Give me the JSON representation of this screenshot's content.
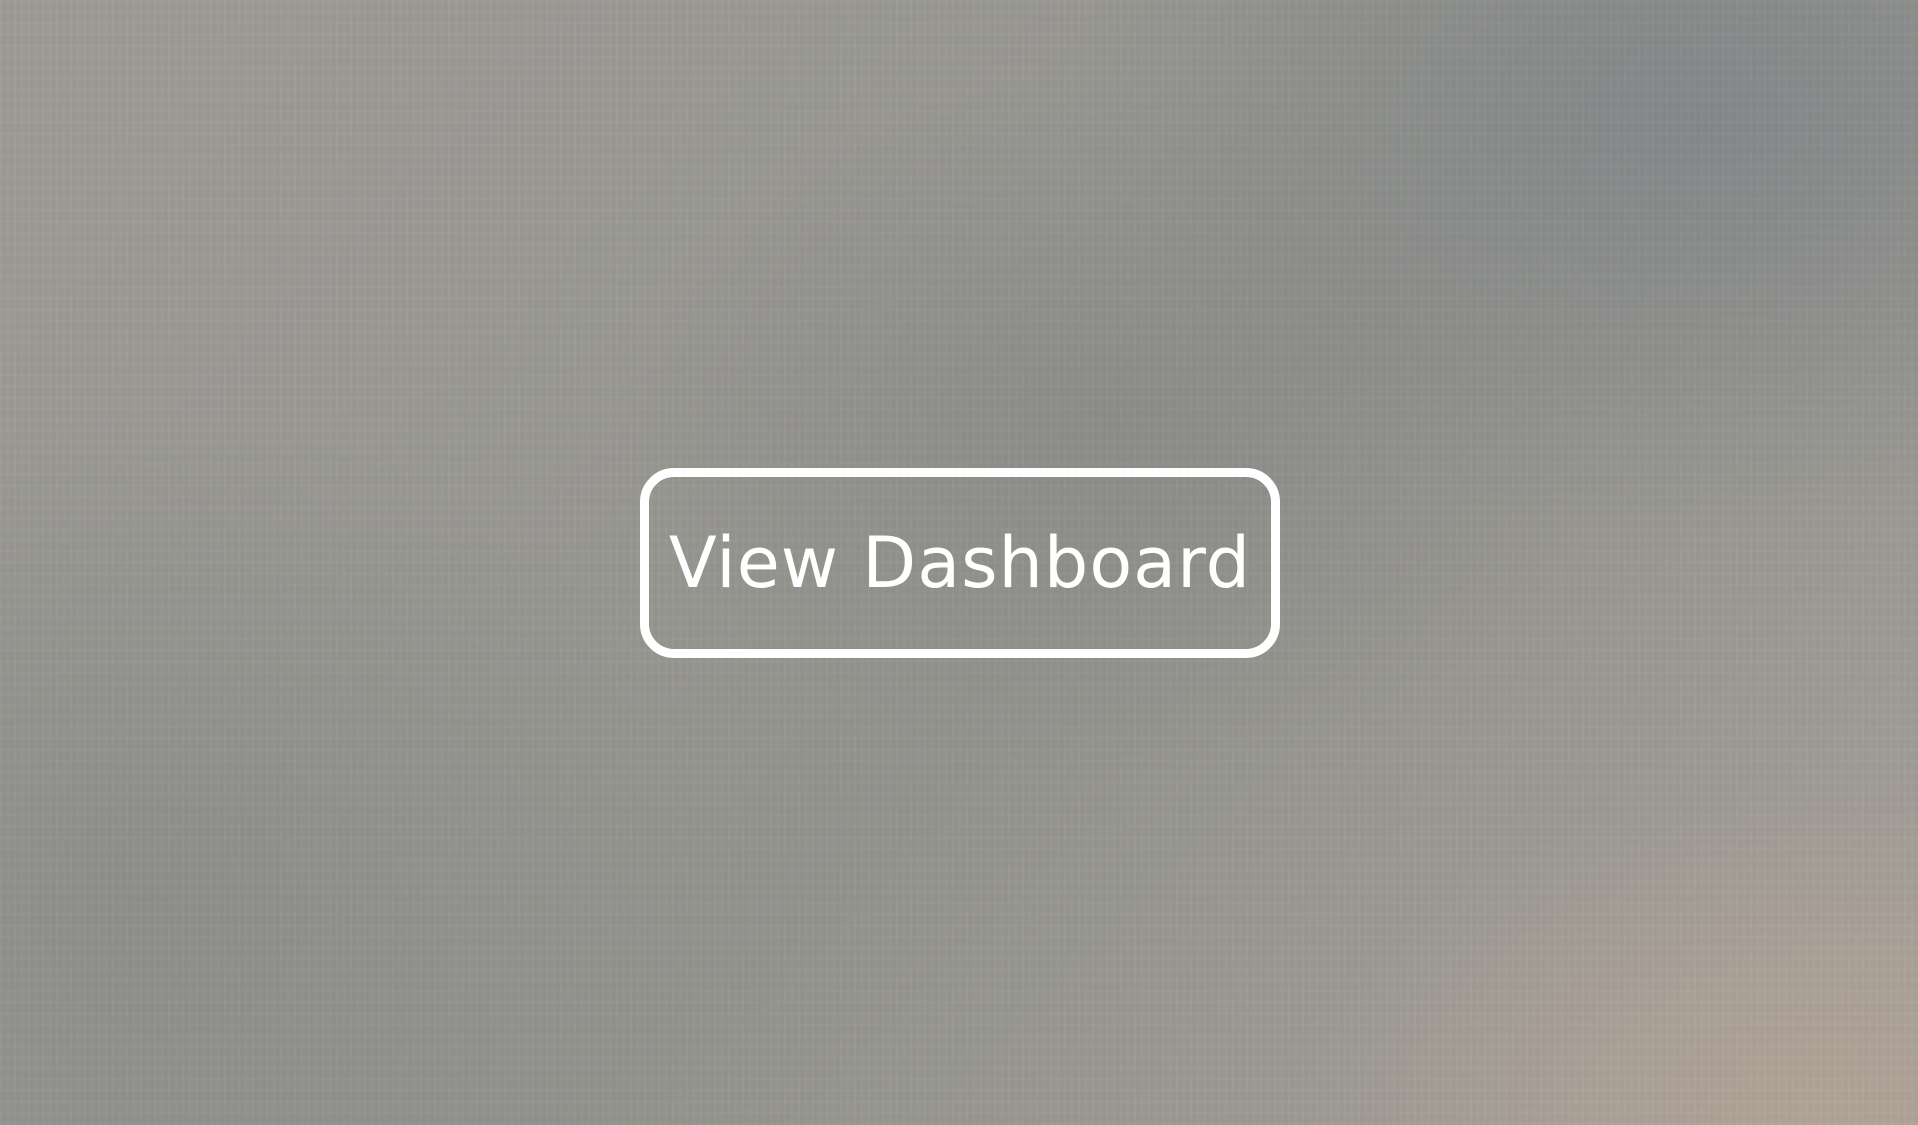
{
  "background": {
    "colors": {
      "base": "#9a9994",
      "top_right": "#84888a",
      "bottom_right_warm": "#b2a498"
    }
  },
  "cta": {
    "label": "View Dashboard",
    "border_color": "#ffffff",
    "text_color": "#ffffff"
  }
}
